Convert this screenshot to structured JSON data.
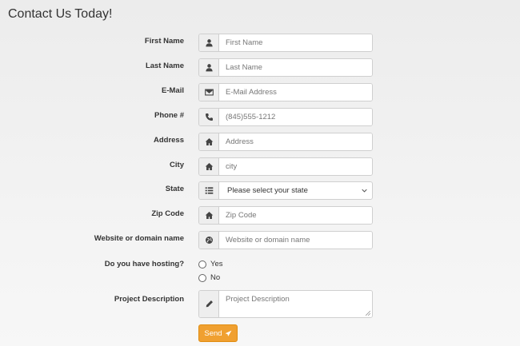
{
  "page_title": "Contact Us Today!",
  "fields": [
    {
      "label": "First Name",
      "placeholder": "First Name",
      "icon": "user-icon"
    },
    {
      "label": "Last Name",
      "placeholder": "Last Name",
      "icon": "user-icon"
    },
    {
      "label": "E-Mail",
      "placeholder": "E-Mail Address",
      "icon": "envelope-icon"
    },
    {
      "label": "Phone #",
      "placeholder": "(845)555-1212",
      "icon": "phone-icon"
    },
    {
      "label": "Address",
      "placeholder": "Address",
      "icon": "home-icon"
    },
    {
      "label": "City",
      "placeholder": "city",
      "icon": "home-icon"
    }
  ],
  "state": {
    "label": "State",
    "selected": "Please select your state",
    "icon": "list-icon"
  },
  "zip": {
    "label": "Zip Code",
    "placeholder": "Zip Code",
    "icon": "home-icon"
  },
  "website": {
    "label": "Website or domain name",
    "placeholder": "Website or domain name",
    "icon": "globe-icon"
  },
  "hosting": {
    "label": "Do you have hosting?",
    "options": [
      "Yes",
      "No"
    ]
  },
  "project": {
    "label": "Project Description",
    "placeholder": "Project Description",
    "icon": "pencil-icon"
  },
  "send_label": "Send",
  "colors": {
    "send_button": "#f0a030",
    "addon_bg": "#eeeeee"
  }
}
